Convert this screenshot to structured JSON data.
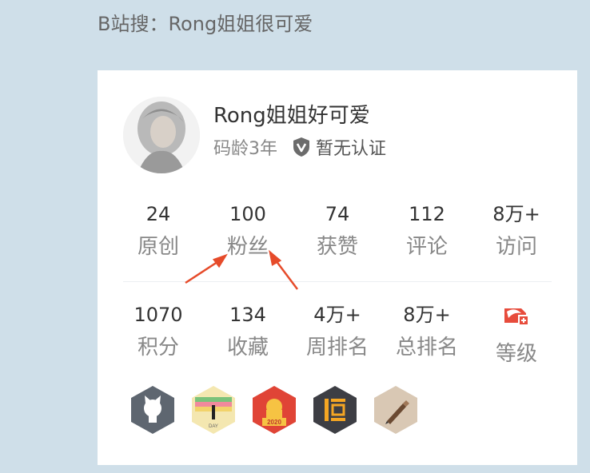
{
  "caption": "B站搜：Rong姐姐很可爱",
  "profile": {
    "name": "Rong姐姐好可爱",
    "code_age": "码龄3年",
    "verification": "暂无认证"
  },
  "stats_row1": [
    {
      "value": "24",
      "label": "原创"
    },
    {
      "value": "100",
      "label": "粉丝"
    },
    {
      "value": "74",
      "label": "获赞"
    },
    {
      "value": "112",
      "label": "评论"
    },
    {
      "value": "8万+",
      "label": "访问"
    }
  ],
  "stats_row2": [
    {
      "value": "1070",
      "label": "积分"
    },
    {
      "value": "134",
      "label": "收藏"
    },
    {
      "value": "4万+",
      "label": "周排名"
    },
    {
      "value": "8万+",
      "label": "总排名"
    },
    {
      "label": "等级"
    }
  ],
  "badges": [
    {
      "icon": "github-badge-icon"
    },
    {
      "icon": "persistence-badge-icon",
      "text": "DAY"
    },
    {
      "icon": "2020-badge-icon",
      "text": "2020"
    },
    {
      "icon": "heng-badge-icon"
    },
    {
      "icon": "pencil-badge-icon"
    }
  ],
  "colors": {
    "background": "#cfdfe9",
    "annotation_arrow": "#e64b2a"
  }
}
